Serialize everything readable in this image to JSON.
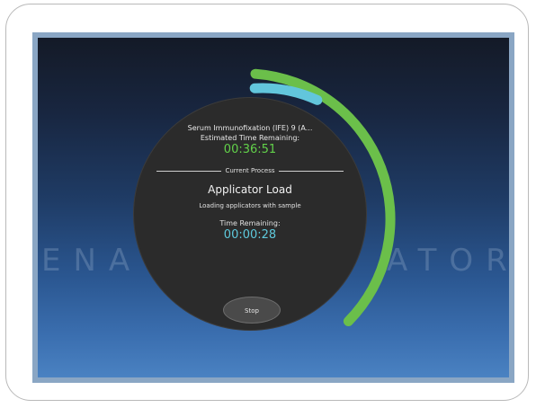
{
  "watermark": {
    "left": "ENA",
    "right": "ATORI"
  },
  "progress": {
    "overall_color": "#6bbf4a",
    "process_color": "#62c6dc"
  },
  "dialog": {
    "test_name": "Serum Immunofixation (IFE) 9 (A...",
    "estimated_label": "Estimated Time Remaining:",
    "estimated_time": "00:36:51",
    "section_label": "Current Process",
    "process_name": "Applicator Load",
    "process_description": "Loading applicators with sample",
    "remaining_label": "Time Remaining:",
    "remaining_time": "00:00:28",
    "stop_label": "Stop"
  }
}
